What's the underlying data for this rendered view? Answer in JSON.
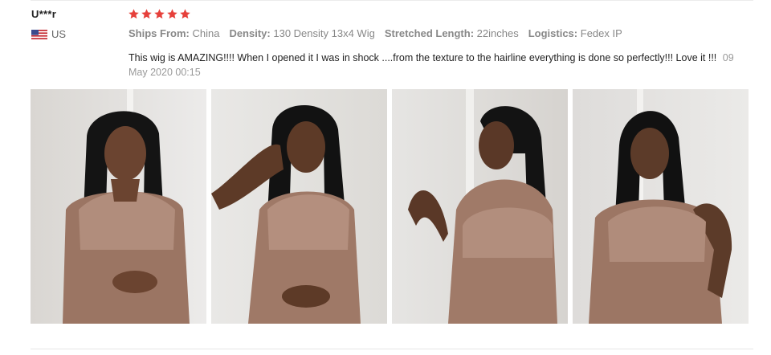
{
  "review": {
    "user": "U***r",
    "country": "US",
    "flag_icon": "us-flag-icon",
    "rating": 5,
    "star_color": "#e6403b",
    "attributes": [
      {
        "label": "Ships From:",
        "value": "China"
      },
      {
        "label": "Density:",
        "value": "130 Density 13x4 Wig"
      },
      {
        "label": "Stretched Length:",
        "value": "22inches"
      },
      {
        "label": "Logistics:",
        "value": "Fedex IP"
      }
    ],
    "text": "This wig is AMAZING!!!! When I opened it I was in shock ....from the texture to the hairline everything is done so perfectly!!! Love it !!!",
    "date": "09 May 2020 00:15",
    "photos": [
      {
        "name": "review-photo-1"
      },
      {
        "name": "review-photo-2"
      },
      {
        "name": "review-photo-3"
      },
      {
        "name": "review-photo-4"
      }
    ]
  }
}
